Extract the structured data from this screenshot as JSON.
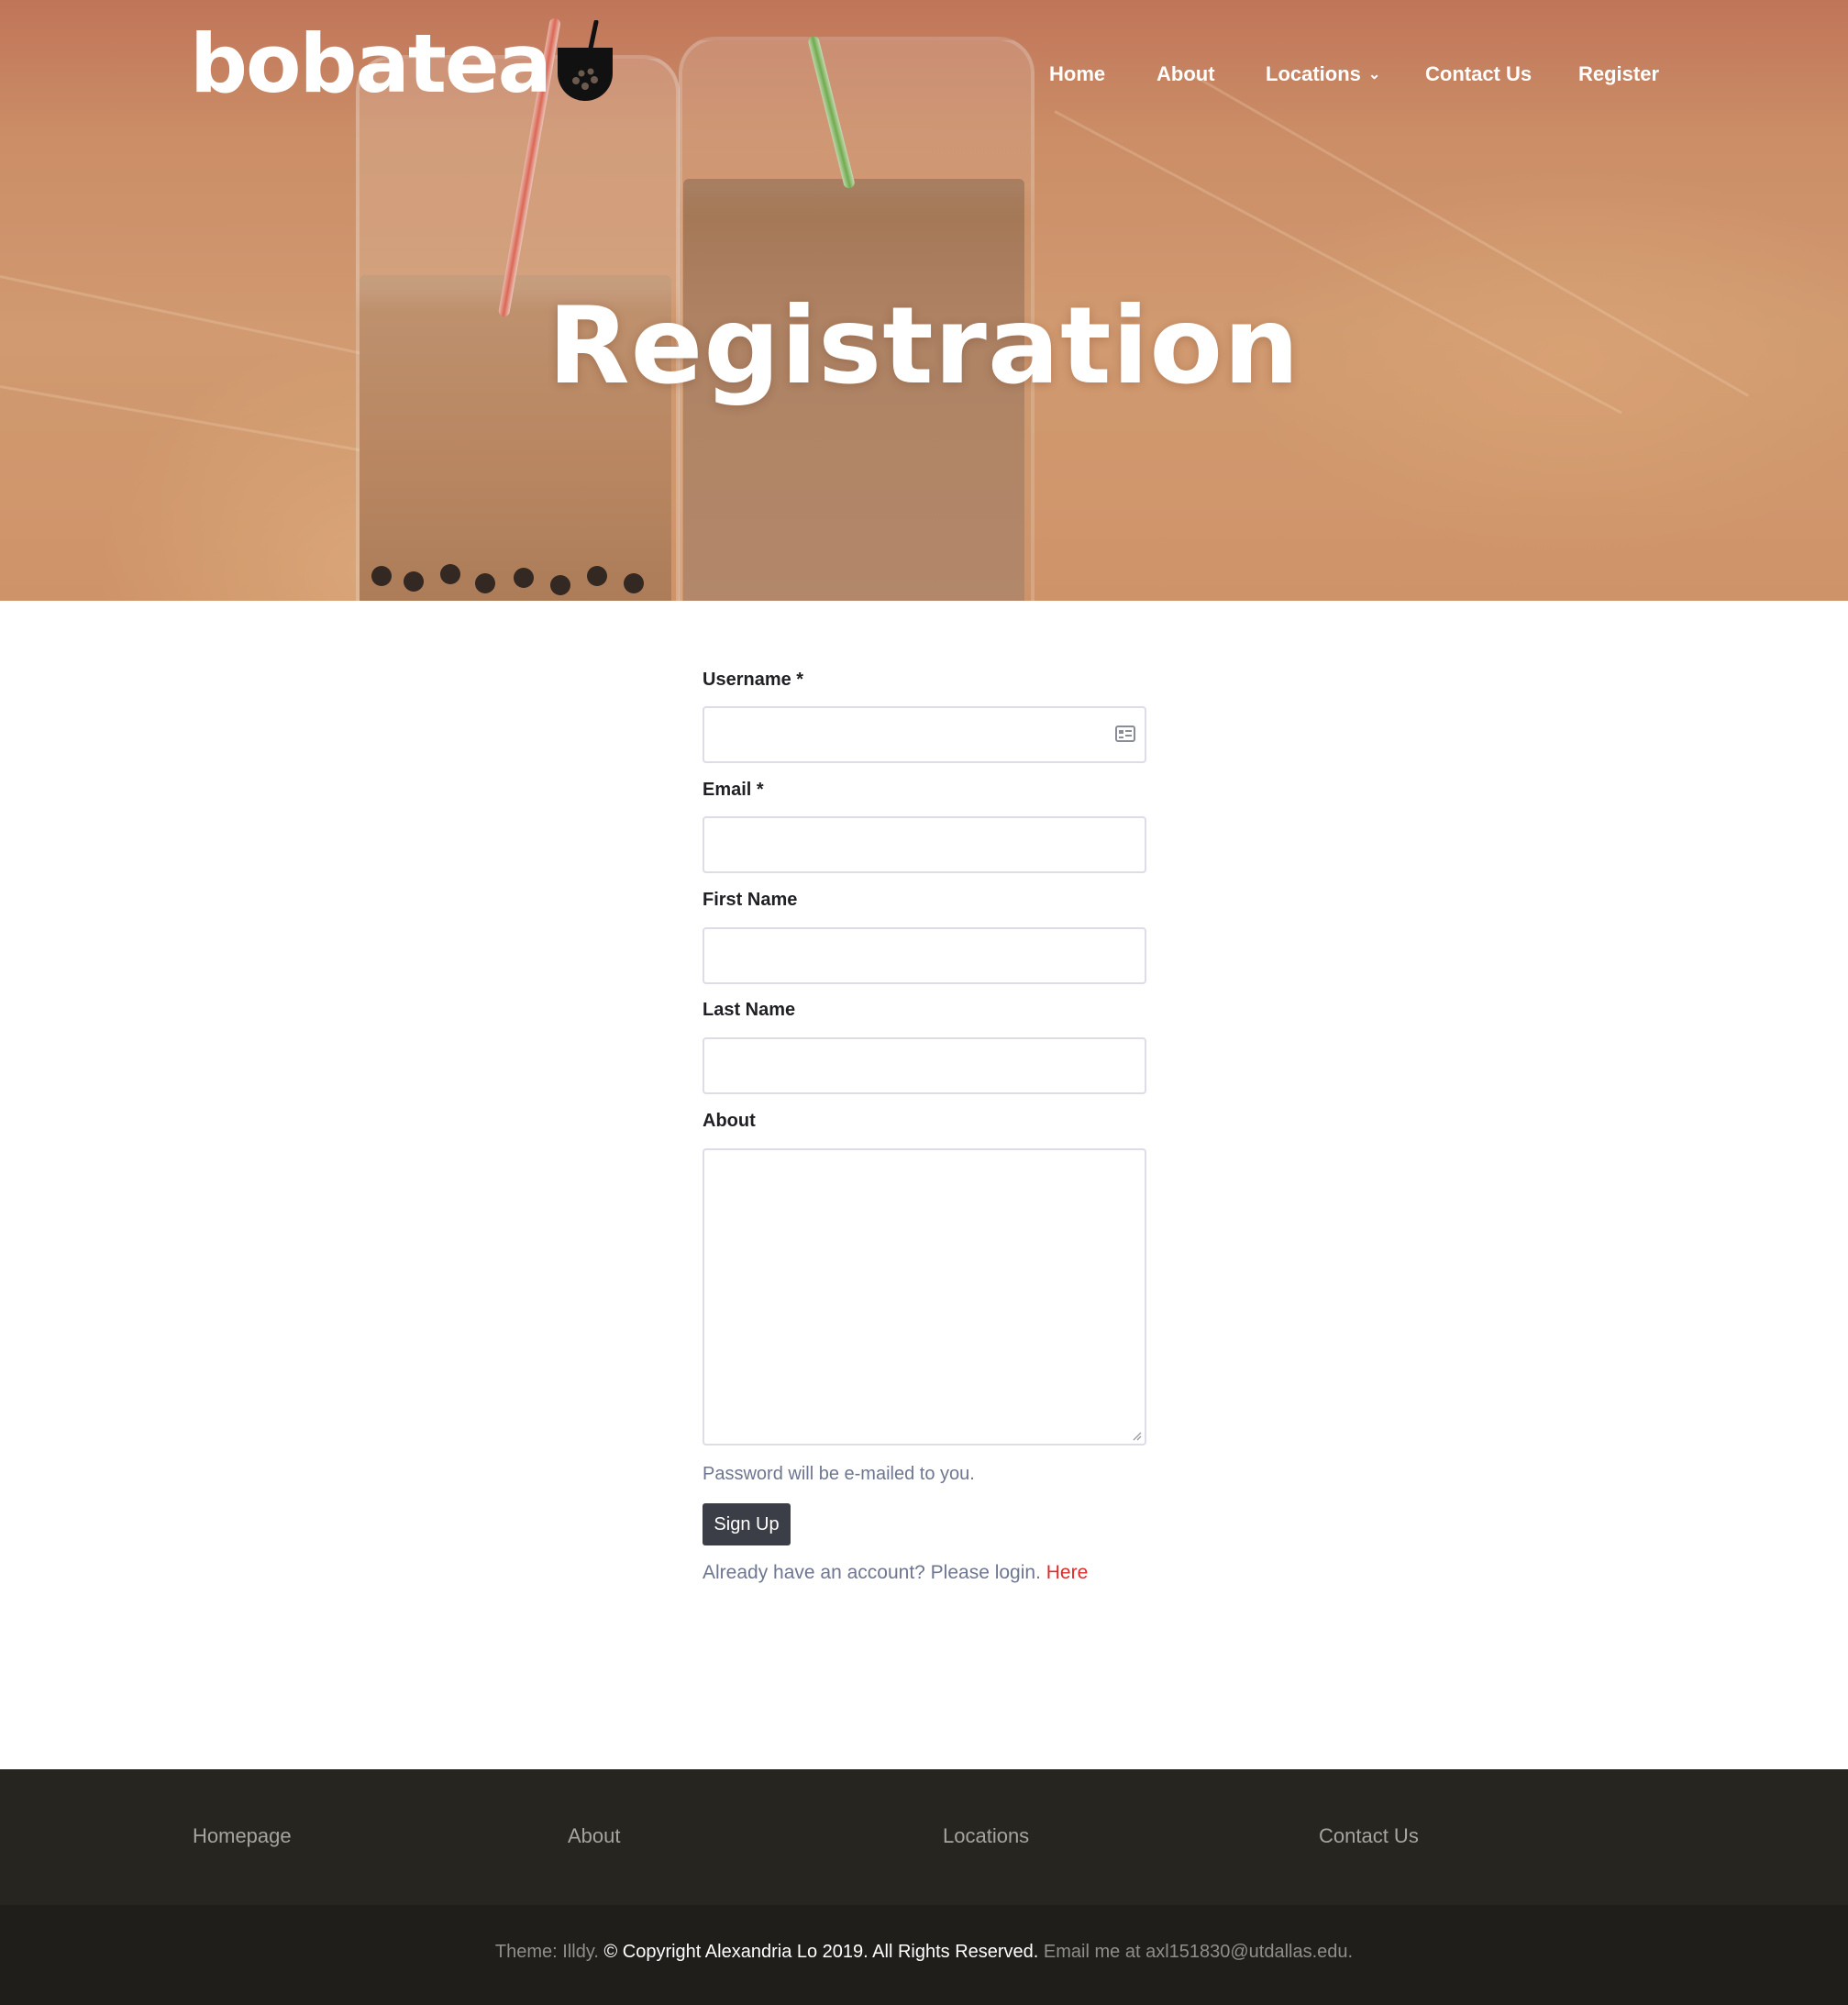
{
  "header": {
    "logo_text": "bobatea",
    "nav": [
      {
        "label": "Home"
      },
      {
        "label": "About"
      },
      {
        "label": "Locations",
        "has_dropdown": true
      },
      {
        "label": "Contact Us"
      },
      {
        "label": "Register"
      }
    ]
  },
  "hero": {
    "title": "Registration"
  },
  "form": {
    "username_label": "Username *",
    "email_label": "Email *",
    "first_name_label": "First Name",
    "last_name_label": "Last Name",
    "about_label": "About",
    "username_value": "",
    "email_value": "",
    "first_name_value": "",
    "last_name_value": "",
    "about_value": "",
    "password_note": "Password will be e-mailed to you.",
    "signup_label": "Sign Up",
    "login_prompt": "Already have an account? Please login.",
    "login_link": "Here"
  },
  "footer": {
    "links": [
      {
        "label": "Homepage"
      },
      {
        "label": "About"
      },
      {
        "label": "Locations"
      },
      {
        "label": "Contact Us"
      }
    ],
    "theme_text": "Theme: Illdy.",
    "copyright_text": "© Copyright Alexandria Lo 2019. All Rights Reserved.",
    "email_text": "Email me at axl151830@utdallas.edu."
  },
  "colors": {
    "hero_tint": "#d3946c",
    "button_bg": "#3b3e47",
    "link_accent": "#e02b2b",
    "footer_top": "#27251f",
    "footer_bottom": "#1f1e1b"
  },
  "icons": {
    "username_field_icon": "contact-card-icon",
    "locations_dropdown_icon": "chevron-down-icon"
  }
}
